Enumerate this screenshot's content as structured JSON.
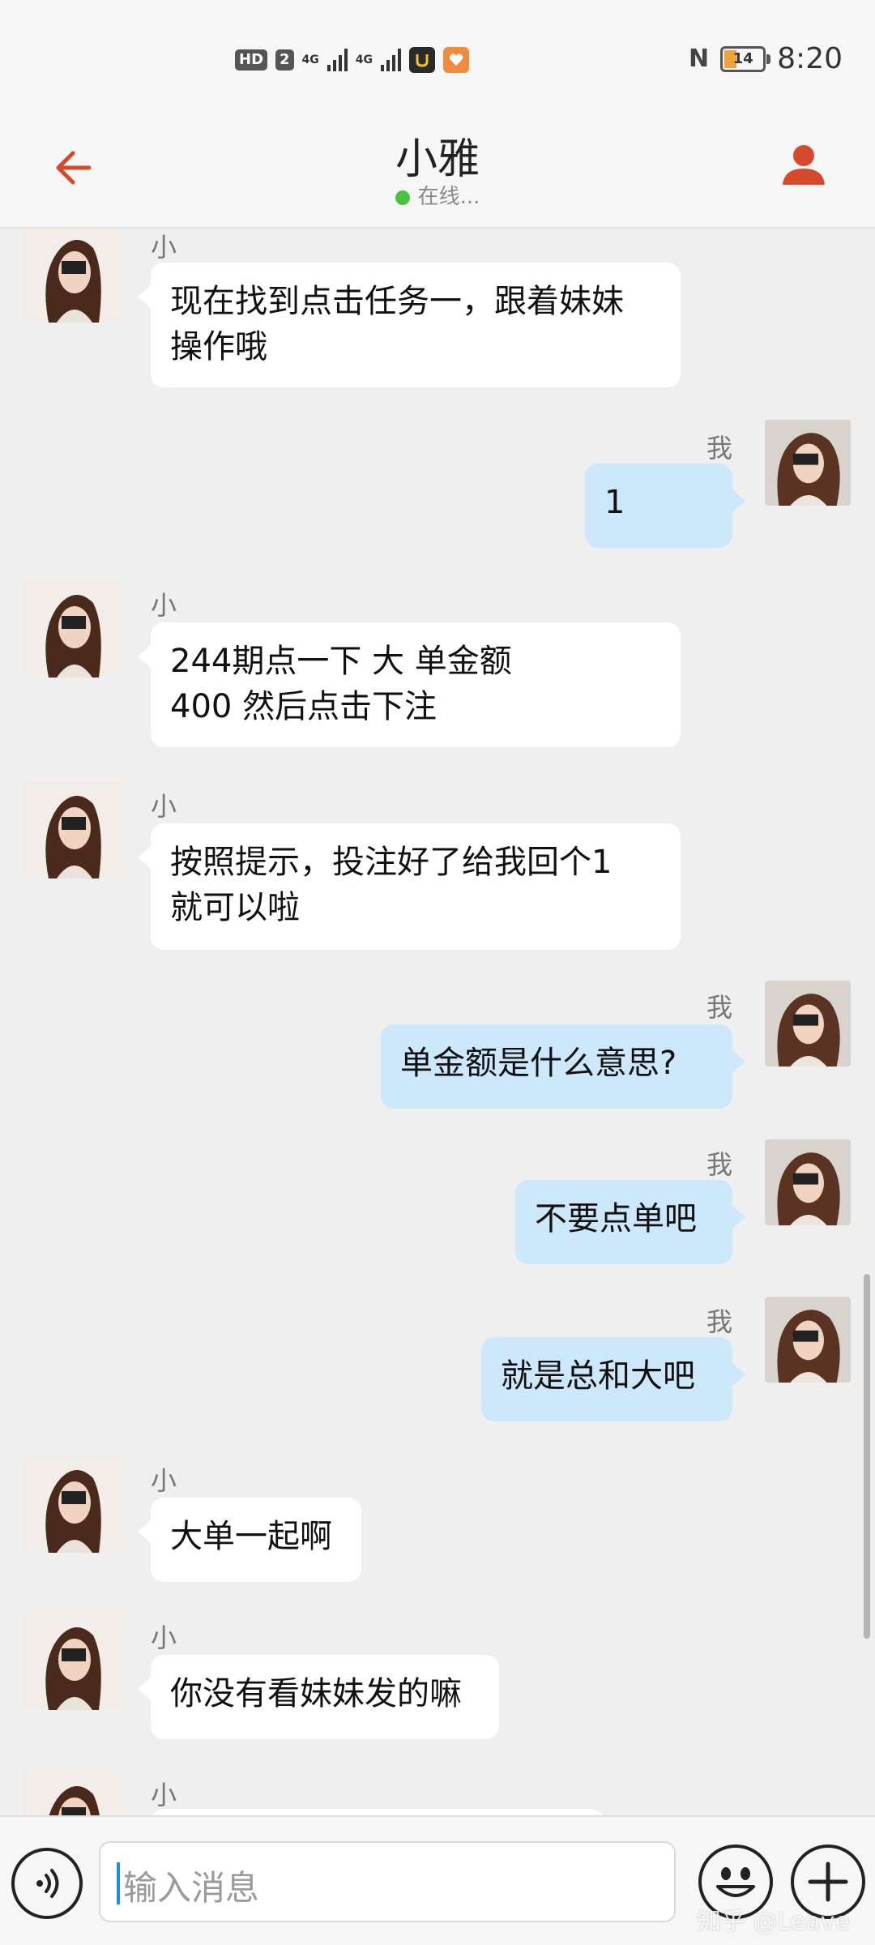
{
  "status_bar": {
    "hd_badge": "HD",
    "sim_badge": "2",
    "signal1_label": "4G",
    "signal2_label": "4G",
    "time": "8:20",
    "nfc_label": "N",
    "battery_level": "14",
    "icons": [
      "hd-icon",
      "signal-icon",
      "signal-icon",
      "app-icon",
      "app-icon",
      "nfc-icon",
      "battery-icon"
    ]
  },
  "header": {
    "title": "小雅",
    "presence": "在线...",
    "back_icon": "arrow-left-icon",
    "profile_icon": "person-icon",
    "accent": "#d64a2c",
    "online_color": "#4cc13f"
  },
  "messages": [
    {
      "from": "contact",
      "sender": "小雅",
      "text": "现在找到点击任务一，跟着妹妹\n操作哦"
    },
    {
      "from": "me",
      "sender": "我",
      "text": "1"
    },
    {
      "from": "contact",
      "sender": "小雅",
      "text": "244期点一下 大          单金额\n400             然后点击下注"
    },
    {
      "from": "contact",
      "sender": "小雅",
      "text": "按照提示，投注好了给我回个1\n就可以啦"
    },
    {
      "from": "me",
      "sender": "我",
      "text": "单金额是什么意思?"
    },
    {
      "from": "me",
      "sender": "我",
      "text": "不要点单吧"
    },
    {
      "from": "me",
      "sender": "我",
      "text": "就是总和大吧"
    },
    {
      "from": "contact",
      "sender": "小雅",
      "text": "大单一起啊"
    },
    {
      "from": "contact",
      "sender": "小雅",
      "text": "你没有看妹妹发的嘛"
    },
    {
      "from": "contact",
      "sender": "小雅",
      "text": ""
    }
  ],
  "composer": {
    "placeholder": "输入消息",
    "voice_icon": "voice-icon",
    "emoji_icon": "emoji-icon",
    "plus_icon": "plus-icon",
    "watermark": "知乎 @Leave"
  },
  "colors": {
    "incoming_bubble": "#ffffff",
    "outgoing_bubble": "#cde7fb",
    "background": "#efefef"
  }
}
